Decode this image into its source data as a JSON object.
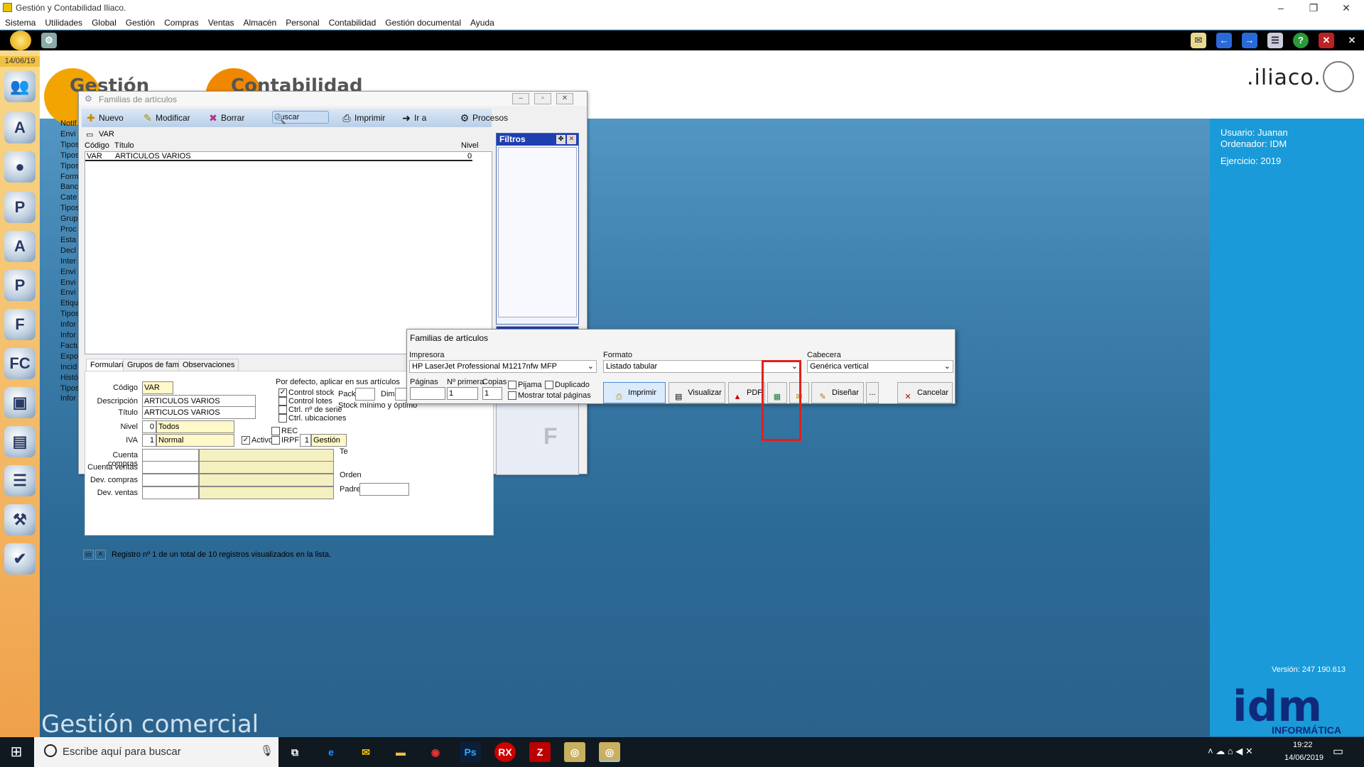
{
  "window": {
    "title": "Gestión y Contabilidad Iliaco."
  },
  "menu": [
    "Sistema",
    "Utilidades",
    "Global",
    "Gestión",
    "Compras",
    "Ventas",
    "Almacén",
    "Personal",
    "Contabilidad",
    "Gestión documental",
    "Ayuda"
  ],
  "sidebar": {
    "date": "14/06/19",
    "labels": [
      "Notif",
      "Envi",
      "Tipos",
      "Tipos",
      "Tipos",
      "Form",
      "Banc",
      "Cate",
      "Tipos",
      "Grup",
      "Proc",
      "Esta",
      "Decl",
      "Inter",
      "Envi",
      "Envi",
      "Envi",
      "Etiqu",
      "Tipos",
      "Infor",
      "Infor",
      "Factu",
      "Expo",
      "Incid",
      "Histó",
      "Tipos",
      "Infor"
    ]
  },
  "brand": {
    "logo1": "Gestión",
    "logo2": "Contabilidad",
    "iliaco": ".iliaco.",
    "footer": "Gestión comercial",
    "version": "Versión: 247 190.613",
    "idm": "idm",
    "idm_sub": "INFORMÁTICA"
  },
  "user_panel": {
    "usuario": "Usuario: Juanan",
    "ordenador": "Ordenador: IDM",
    "ejercicio": "Ejercicio: 2019"
  },
  "dialog": {
    "title": "Familias de artículos",
    "toolbar": [
      "Nuevo",
      "Modificar",
      "Borrar",
      "Buscar",
      "Imprimir",
      "Ir a",
      "Procesos"
    ],
    "search_value": "VAR",
    "filtros": "Filtros",
    "columns": {
      "codigo": "Código",
      "titulo": "Título",
      "nivel": "Nivel"
    },
    "rows": [
      {
        "codigo": "VAR",
        "titulo": "ARTICULOS VARIOS",
        "nivel": "0"
      }
    ],
    "tabs": [
      "Formulario",
      "Grupos de familias",
      "Observaciones"
    ],
    "form": {
      "codigo_label": "Código",
      "codigo": "VAR",
      "descripcion_label": "Descripción",
      "descripcion": "ARTICULOS VARIOS",
      "titulo_label": "Título",
      "titulo": "ARTICULOS VARIOS",
      "nivel_label": "Nivel",
      "nivel_num": "0",
      "nivel_text": "Todos",
      "iva_label": "IVA",
      "iva_num": "1",
      "iva_text": "Normal",
      "activo": "Activo",
      "cuenta_compras": "Cuenta compras",
      "cuenta_ventas": "Cuenta ventas",
      "dev_compras": "Dev. compras",
      "dev_ventas": "Dev. ventas",
      "defaults_title": "Por defecto, aplicar en sus artículos",
      "control_stock": "Control stock",
      "control_lotes": "Control lotes",
      "ctrl_serie": "Ctrl. nº de serie",
      "ctrl_ubicaciones": "Ctrl. ubicaciones",
      "pack": "Pack",
      "dim": "Dim.",
      "stock_min": "Stock mínimo y óptimo",
      "rec": "REC",
      "irpf": "IRPF",
      "gestion_num": "1",
      "gestion": "Gestión",
      "te": "Te",
      "orden": "Orden",
      "padre": "Padre"
    },
    "status": "Registro nº 1 de un total de 10 registros visualizados en la lista."
  },
  "print_dialog": {
    "title": "Familias de artículos",
    "impresora_label": "Impresora",
    "impresora": "HP LaserJet Professional M1217nfw MFP",
    "formato_label": "Formato",
    "formato": "Listado tabular",
    "cabecera_label": "Cabecera",
    "cabecera": "Genérica vertical",
    "paginas": "Páginas",
    "primera": "Nº primera",
    "copias": "Copias",
    "primera_val": "1",
    "copias_val": "1",
    "pijama": "Pijama",
    "duplicado": "Duplicado",
    "mostrar_total": "Mostrar total páginas",
    "buttons": {
      "imprimir": "Imprimir",
      "visualizar": "Visualizar",
      "pdf": "PDF",
      "disenar": "Diseñar",
      "more": "...",
      "cancelar": "Cancelar"
    }
  },
  "taskbar": {
    "search_placeholder": "Escribe aquí para buscar",
    "time": "19:22",
    "date": "14/06/2019"
  },
  "colors": {
    "highlight": "#e0201c",
    "filtros_header": "#1e3fb0",
    "right_panel": "#1a9ad8"
  }
}
